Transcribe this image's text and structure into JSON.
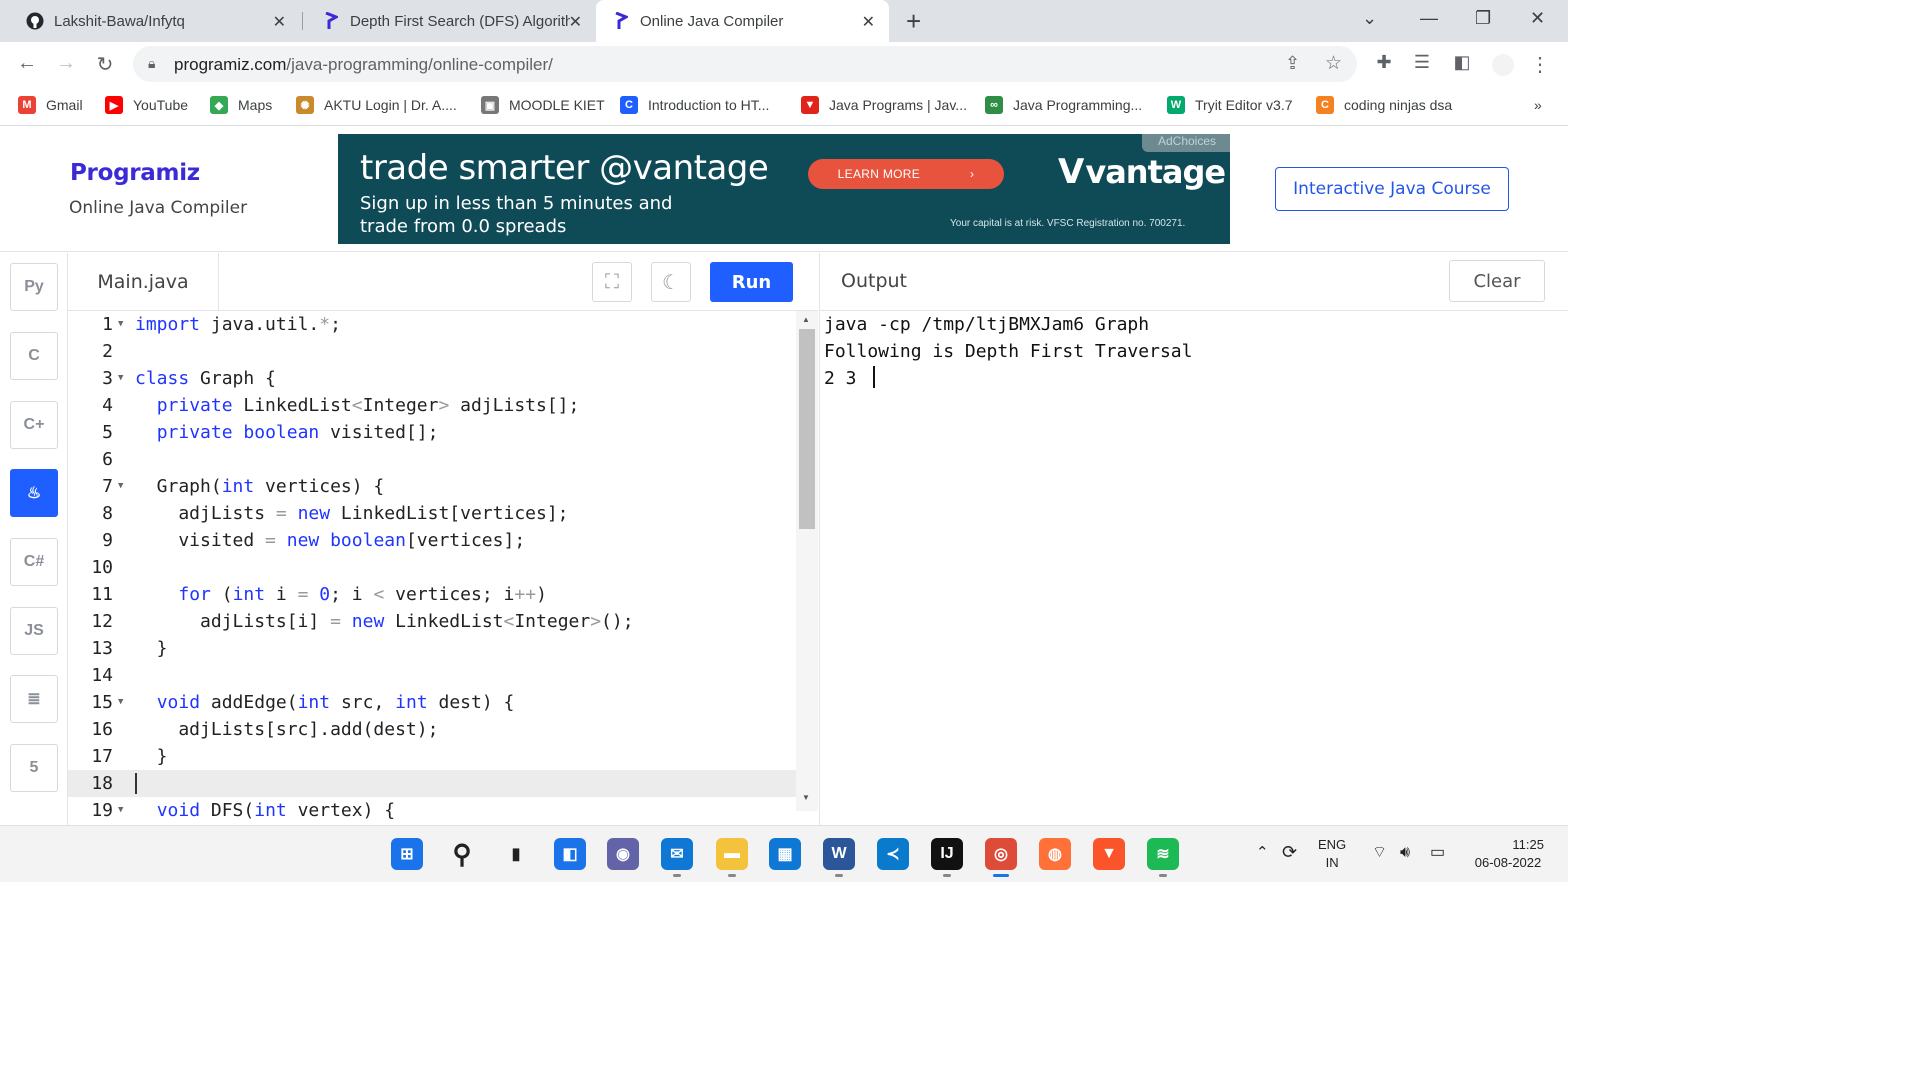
{
  "browser": {
    "tabs": [
      {
        "title": "Lakshit-Bawa/Infytq",
        "icon": "github-icon",
        "active": false
      },
      {
        "title": "Depth First Search (DFS) Algorith",
        "icon": "programiz-icon",
        "active": false
      },
      {
        "title": "Online Java Compiler",
        "icon": "programiz-icon",
        "active": true
      }
    ],
    "new_tab": "+",
    "url_domain": "programiz.com",
    "url_path": "/java-programming/online-compiler/",
    "bookmarks": [
      {
        "label": "Gmail",
        "icon": "gmail-icon",
        "color": "#ea4335",
        "glyph": "M"
      },
      {
        "label": "YouTube",
        "icon": "youtube-icon",
        "color": "#ff0000",
        "glyph": "▶"
      },
      {
        "label": "Maps",
        "icon": "maps-icon",
        "color": "#34a853",
        "glyph": "◆"
      },
      {
        "label": "AKTU Login | Dr. A....",
        "icon": "aktu-icon",
        "color": "#c98a2b",
        "glyph": "✺"
      },
      {
        "label": "MOODLE KIET",
        "icon": "moodle-icon",
        "color": "#777777",
        "glyph": "▣"
      },
      {
        "label": "Introduction to HT...",
        "icon": "c-icon",
        "color": "#1f5eff",
        "glyph": "C"
      },
      {
        "label": "Java Programs | Jav...",
        "icon": "javatpoint-icon",
        "color": "#e2231a",
        "glyph": "▼"
      },
      {
        "label": "Java Programming...",
        "icon": "gfg-icon",
        "color": "#2f8d46",
        "glyph": "∞"
      },
      {
        "label": "Tryit Editor v3.7",
        "icon": "w3-icon",
        "color": "#04aa6d",
        "glyph": "W"
      },
      {
        "label": "coding ninjas dsa",
        "icon": "codingninjas-icon",
        "color": "#f58220",
        "glyph": "C"
      }
    ],
    "bookmarks_more": "»"
  },
  "header": {
    "logo": "Programiz",
    "subtitle": "Online Java Compiler",
    "course_button": "Interactive Java Course"
  },
  "ad": {
    "headline": "trade smarter @vantage",
    "subtext": "Sign up in less than 5 minutes and trade from 0.0 spreads",
    "cta": "LEARN MORE",
    "brand": "vantage",
    "fine_print": "Your capital is at risk. VFSC Registration no. 700271.",
    "choices": "AdChoices"
  },
  "languages": [
    {
      "name": "python-icon",
      "glyph": "Py",
      "active": false
    },
    {
      "name": "c-lang-icon",
      "glyph": "C",
      "active": false
    },
    {
      "name": "cpp-icon",
      "glyph": "C+",
      "active": false
    },
    {
      "name": "java-icon",
      "glyph": "♨",
      "active": true
    },
    {
      "name": "csharp-icon",
      "glyph": "C#",
      "active": false
    },
    {
      "name": "javascript-icon",
      "glyph": "JS",
      "active": false
    },
    {
      "name": "sql-icon",
      "glyph": "≣",
      "active": false
    },
    {
      "name": "html-icon",
      "glyph": "5",
      "active": false
    }
  ],
  "editor": {
    "file_name": "Main.java",
    "run_label": "Run",
    "lines": [
      {
        "n": "1",
        "fold": true,
        "html": "<span class=\"kw\">import</span> java.util.<span class=\"op\">*</span>;"
      },
      {
        "n": "2",
        "fold": false,
        "html": ""
      },
      {
        "n": "3",
        "fold": true,
        "html": "<span class=\"kw\">class</span> Graph {"
      },
      {
        "n": "4",
        "fold": false,
        "html": "  <span class=\"kw\">private</span> LinkedList<span class=\"op\">&lt;</span>Integer<span class=\"op\">&gt;</span> adjLists[];"
      },
      {
        "n": "5",
        "fold": false,
        "html": "  <span class=\"kw\">private</span> <span class=\"kw\">boolean</span> visited[];"
      },
      {
        "n": "6",
        "fold": false,
        "html": ""
      },
      {
        "n": "7",
        "fold": true,
        "html": "  Graph(<span class=\"kw\">int</span> vertices) {"
      },
      {
        "n": "8",
        "fold": false,
        "html": "    adjLists <span class=\"op\">=</span> <span class=\"kw\">new</span> LinkedList[vertices];"
      },
      {
        "n": "9",
        "fold": false,
        "html": "    visited <span class=\"op\">=</span> <span class=\"kw\">new</span> <span class=\"kw\">boolean</span>[vertices];"
      },
      {
        "n": "10",
        "fold": false,
        "html": ""
      },
      {
        "n": "11",
        "fold": false,
        "html": "    <span class=\"kw\">for</span> (<span class=\"kw\">int</span> i <span class=\"op\">=</span> <span class=\"kw\">0</span>; i <span class=\"op\">&lt;</span> vertices; i<span class=\"op\">++</span>)"
      },
      {
        "n": "12",
        "fold": false,
        "html": "      adjLists[i] <span class=\"op\">=</span> <span class=\"kw\">new</span> LinkedList<span class=\"op\">&lt;</span>Integer<span class=\"op\">&gt;</span>();"
      },
      {
        "n": "13",
        "fold": false,
        "html": "  }"
      },
      {
        "n": "14",
        "fold": false,
        "html": ""
      },
      {
        "n": "15",
        "fold": true,
        "html": "  <span class=\"kw\">void</span> addEdge(<span class=\"kw\">int</span> src, <span class=\"kw\">int</span> dest) {"
      },
      {
        "n": "16",
        "fold": false,
        "html": "    adjLists[src].add(dest);"
      },
      {
        "n": "17",
        "fold": false,
        "html": "  }"
      },
      {
        "n": "18",
        "fold": false,
        "html": "",
        "current": true
      },
      {
        "n": "19",
        "fold": true,
        "html": "  <span class=\"kw\">void</span> DFS(<span class=\"kw\">int</span> vertex) {"
      }
    ]
  },
  "output": {
    "title": "Output",
    "clear_label": "Clear",
    "lines": [
      "java -cp /tmp/ltjBMXJam6 Graph",
      "Following is Depth First Traversal",
      "2 3 "
    ]
  },
  "taskbar": {
    "apps": [
      {
        "name": "start-icon",
        "glyph": "⊞",
        "color": "#1a73e8"
      },
      {
        "name": "search-icon",
        "glyph": "⚲",
        "color": "#222222"
      },
      {
        "name": "task-view-icon",
        "glyph": "▮",
        "color": "#222222"
      },
      {
        "name": "widgets-icon",
        "glyph": "◧",
        "color": "#1a73e8"
      },
      {
        "name": "teams-chat-icon",
        "glyph": "◉",
        "color": "#6264a7"
      },
      {
        "name": "mail-icon",
        "glyph": "✉",
        "color": "#0f78d4"
      },
      {
        "name": "file-explorer-icon",
        "glyph": "▬",
        "color": "#f5c33b"
      },
      {
        "name": "store-icon",
        "glyph": "▦",
        "color": "#0f78d4"
      },
      {
        "name": "word-icon",
        "glyph": "W",
        "color": "#2b579a"
      },
      {
        "name": "vscode-icon",
        "glyph": "≺",
        "color": "#0a7acc"
      },
      {
        "name": "intellij-icon",
        "glyph": "IJ",
        "color": "#111111"
      },
      {
        "name": "chrome-icon",
        "glyph": "◎",
        "color": "#dd4b39"
      },
      {
        "name": "firefox-icon",
        "glyph": "◍",
        "color": "#ff7139"
      },
      {
        "name": "brave-icon",
        "glyph": "▼",
        "color": "#fb542b"
      },
      {
        "name": "spotify-icon",
        "glyph": "≋",
        "color": "#1db954"
      }
    ],
    "lang_top": "ENG",
    "lang_bottom": "IN",
    "time": "11:25",
    "date": "06-08-2022"
  }
}
